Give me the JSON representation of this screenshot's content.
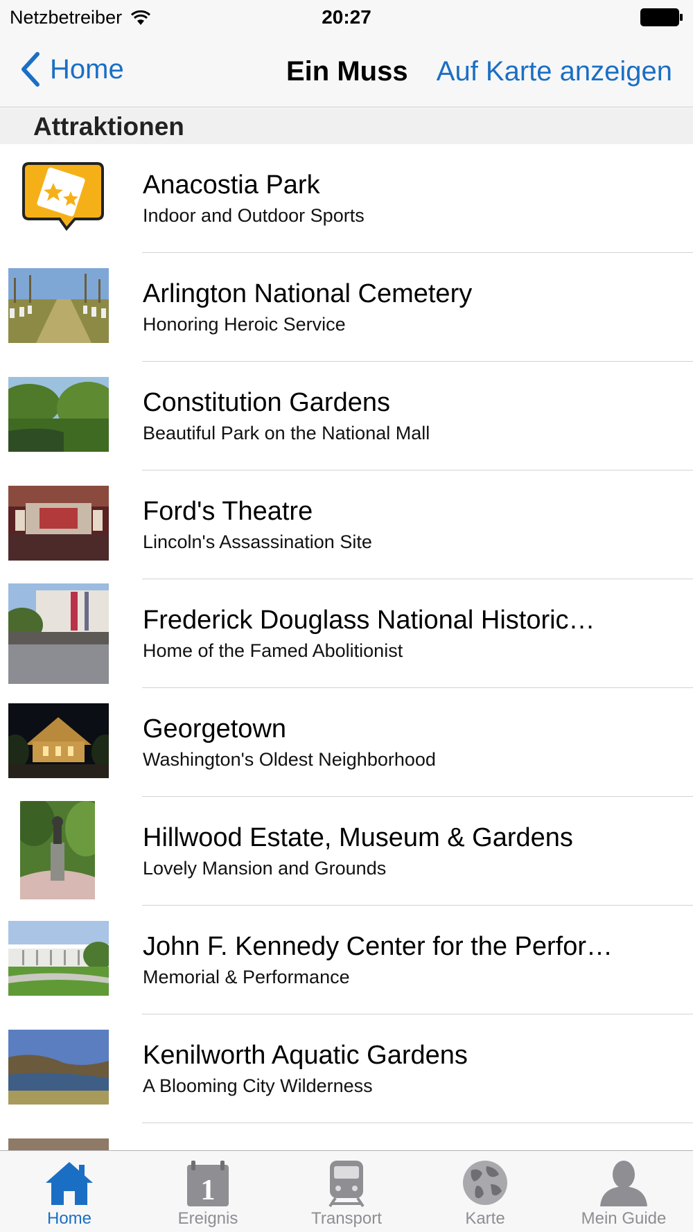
{
  "status_bar": {
    "carrier": "Netzbetreiber",
    "time": "20:27"
  },
  "nav_bar": {
    "back_label": "Home",
    "title": "Ein Muss",
    "map_button": "Auf Karte anzeigen"
  },
  "section": {
    "title": "Attraktionen"
  },
  "items": [
    {
      "title": "Anacostia Park",
      "subtitle": "Indoor and Outdoor Sports"
    },
    {
      "title": "Arlington National Cemetery",
      "subtitle": "Honoring Heroic Service"
    },
    {
      "title": "Constitution Gardens",
      "subtitle": "Beautiful Park on the National Mall"
    },
    {
      "title": "Ford's Theatre",
      "subtitle": "Lincoln's Assassination Site"
    },
    {
      "title": "Frederick Douglass National Historic…",
      "subtitle": "Home of the Famed Abolitionist"
    },
    {
      "title": "Georgetown",
      "subtitle": "Washington's Oldest Neighborhood"
    },
    {
      "title": "Hillwood Estate, Museum & Gardens",
      "subtitle": "Lovely Mansion and Grounds"
    },
    {
      "title": "John F. Kennedy Center for the Perfor…",
      "subtitle": "Memorial & Performance"
    },
    {
      "title": "Kenilworth Aquatic Gardens",
      "subtitle": "A Blooming City Wilderness"
    },
    {
      "title": "",
      "subtitle": ""
    }
  ],
  "tabs": [
    {
      "label": "Home",
      "icon": "home-icon",
      "active": true
    },
    {
      "label": "Ereignis",
      "icon": "calendar-icon",
      "active": false
    },
    {
      "label": "Transport",
      "icon": "train-icon",
      "active": false
    },
    {
      "label": "Karte",
      "icon": "globe-icon",
      "active": false
    },
    {
      "label": "Mein Guide",
      "icon": "person-icon",
      "active": false
    }
  ],
  "colors": {
    "accent": "#1a6fc4",
    "inactive_tab": "#8e8e93",
    "bar_background": "#f7f7f7",
    "section_background": "#f0f0f0",
    "separator": "#d2d2d6"
  }
}
